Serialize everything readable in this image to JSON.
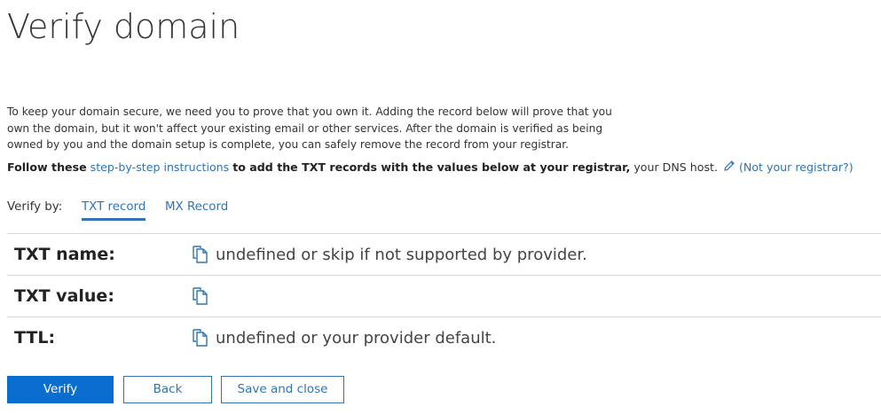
{
  "page": {
    "title": "Verify domain"
  },
  "intro": {
    "text": "To keep your domain secure, we need you to prove that you own it. Adding the record below will prove that you own the domain, but it won't affect your existing email or other services. After the domain is verified as being owned by you and the domain setup is complete, you can safely remove the record from your registrar."
  },
  "instructions": {
    "prefix": "Follow these",
    "link": "step-by-step instructions",
    "middle": "to add the TXT records with the values below at your registrar,",
    "suffix": "your DNS host.",
    "edit_icon": "pencil-icon",
    "not_registrar_link": "(Not your registrar?)"
  },
  "verify_by": {
    "label": "Verify by:",
    "tabs": [
      {
        "label": "TXT record",
        "active": true
      },
      {
        "label": "MX Record",
        "active": false
      }
    ]
  },
  "records": [
    {
      "label": "TXT name:",
      "icon": "copy-icon",
      "value": "undefined or skip if not supported by provider."
    },
    {
      "label": "TXT value:",
      "icon": "copy-icon",
      "value": ""
    },
    {
      "label": "TTL:",
      "icon": "copy-icon",
      "value": "undefined or your provider default."
    }
  ],
  "buttons": {
    "verify": "Verify",
    "back": "Back",
    "save_close": "Save and close"
  },
  "colors": {
    "link": "#2f74b5",
    "primary_button": "#0a6ed1",
    "divider": "#d9d9d9",
    "text": "#333333"
  }
}
